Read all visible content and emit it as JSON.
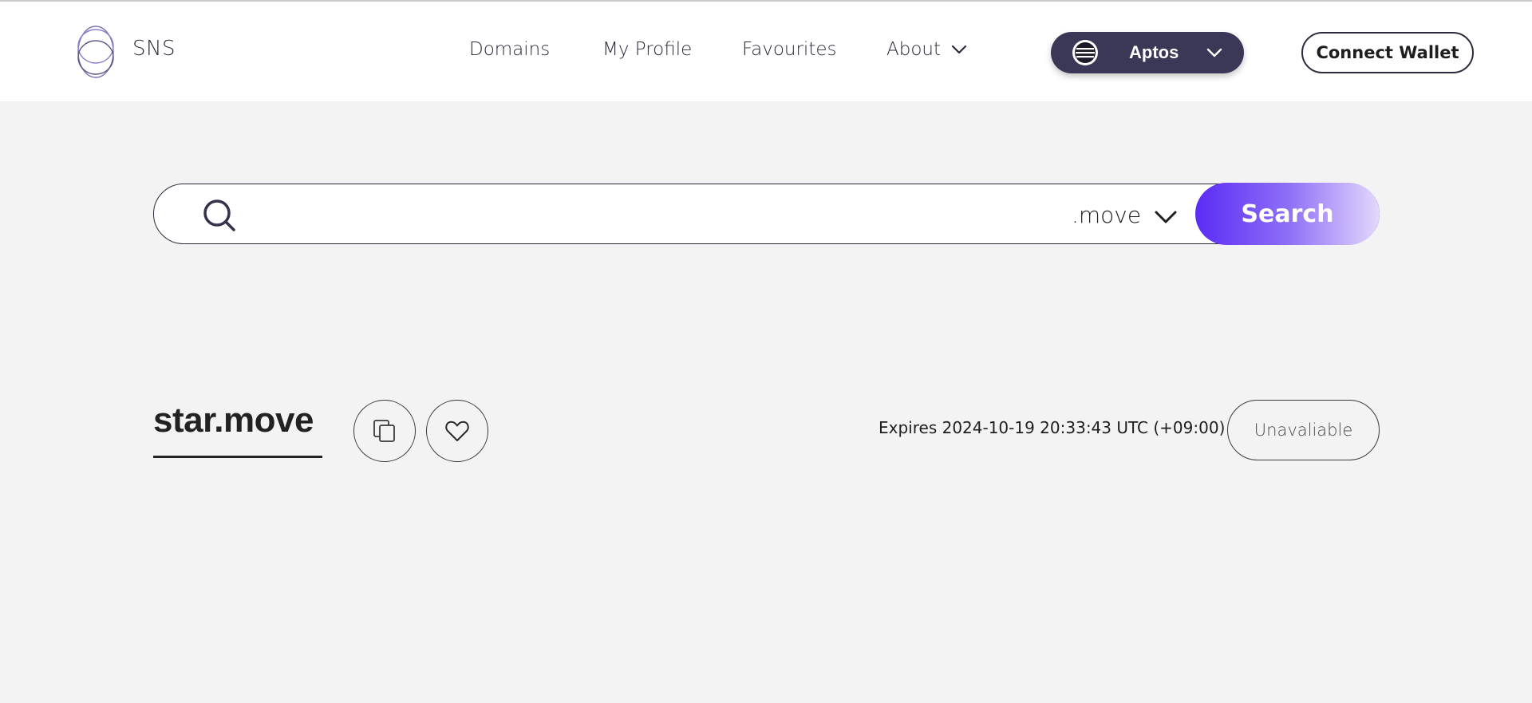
{
  "header": {
    "brand": "SNS",
    "nav": {
      "domains": "Domains",
      "my_profile": "My Profile",
      "favourites": "Favourites",
      "about": "About"
    },
    "network": {
      "label": "Aptos",
      "icon": "aptos-logo-icon"
    },
    "connect_wallet": "Connect Wallet"
  },
  "search": {
    "value": "",
    "placeholder": "",
    "tld": ".move",
    "button_label": "Search"
  },
  "result": {
    "domain": "star.move",
    "expires": "Expires 2024-10-19 20:33:43 UTC (+09:00)",
    "status": "Unavaliable"
  },
  "colors": {
    "accent": "#5a2cf6",
    "network_bg": "#3a3856",
    "page_bg": "#f3f3f3"
  }
}
